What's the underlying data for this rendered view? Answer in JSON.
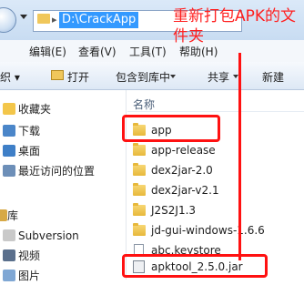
{
  "address_bar": {
    "path": "D:\\CrackApp",
    "separator": "▸"
  },
  "menu": {
    "edit": "编辑(E)",
    "view": "查看(V)",
    "tools": "工具(T)",
    "help": "帮助(H)"
  },
  "toolbar": {
    "organize": "织 ▾",
    "open": "打开",
    "include_in_library": "包含到库中",
    "share": "共享",
    "new": "新建"
  },
  "nav": {
    "favorites": "收藏夹",
    "downloads": "下载",
    "desktop": "桌面",
    "recent": "最近访问的位置",
    "library": "库",
    "subversion": "Subversion",
    "videos": "视频",
    "pictures": "图片"
  },
  "list": {
    "column_name": "名称",
    "files": [
      {
        "name": "app",
        "type": "folder"
      },
      {
        "name": "app-release",
        "type": "folder"
      },
      {
        "name": "dex2jar-2.0",
        "type": "folder"
      },
      {
        "name": "dex2jar-v2.1",
        "type": "folder"
      },
      {
        "name": "J2S2J1.3",
        "type": "folder"
      },
      {
        "name": "jd-gui-windows-1.6.6",
        "type": "folder"
      },
      {
        "name": "abc.keystore",
        "type": "file"
      },
      {
        "name": "apktool_2.5.0.jar",
        "type": "jar"
      }
    ]
  },
  "annotation": {
    "text": "重新打包APK的文件夹",
    "color": "#ff1111"
  }
}
